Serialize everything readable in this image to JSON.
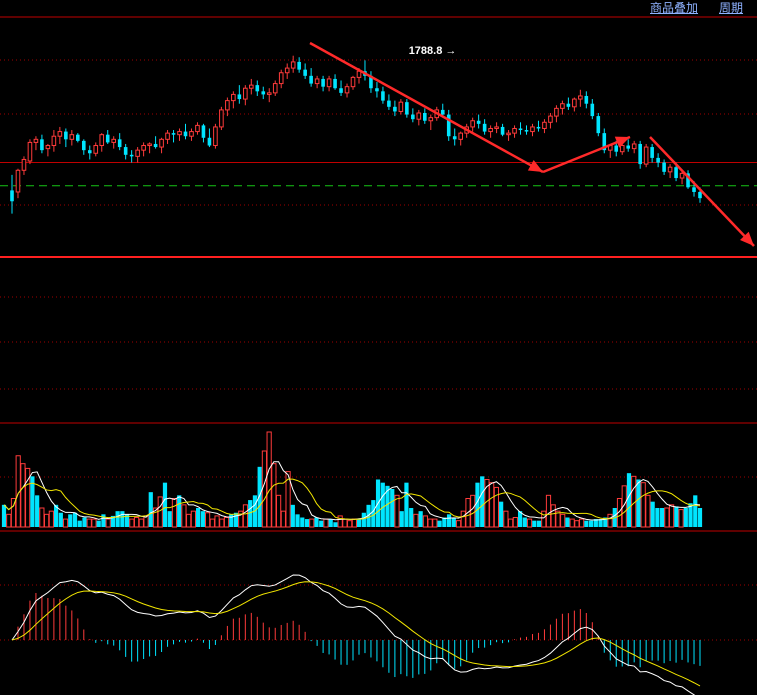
{
  "toolbar": {
    "overlay_label": "商品叠加",
    "period_label": "周期"
  },
  "colors": {
    "background": "#000000",
    "up": "#ff3b3b",
    "down": "#00e5ff",
    "frame": "#c00000",
    "dotted": "#a00000",
    "dashed_support": "#16c616",
    "ma_white": "#ffffff",
    "ma_yellow": "#f2e600",
    "arrow": "#ff2a2a"
  },
  "chart_data": [
    {
      "type": "candlestick",
      "panel": "price",
      "annotations": [
        {
          "text": "1788.8",
          "value": 1788.8,
          "at_index": 75
        }
      ],
      "support_line_value": 1701,
      "resistance_line_value": 1716,
      "floor_line_value": 1661,
      "ylim": [
        1655,
        1810
      ],
      "candles_ohlc": [
        [
          1698,
          1708,
          1683,
          1691
        ],
        [
          1697,
          1712,
          1693,
          1711
        ],
        [
          1711,
          1720,
          1708,
          1718
        ],
        [
          1717,
          1731,
          1715,
          1729
        ],
        [
          1729,
          1733,
          1724,
          1731
        ],
        [
          1731,
          1734,
          1722,
          1724
        ],
        [
          1725,
          1728,
          1720,
          1727
        ],
        [
          1727,
          1737,
          1723,
          1733
        ],
        [
          1733,
          1739,
          1728,
          1736
        ],
        [
          1736,
          1738,
          1726,
          1731
        ],
        [
          1731,
          1737,
          1727,
          1734
        ],
        [
          1734,
          1735,
          1729,
          1730
        ],
        [
          1730,
          1731,
          1721,
          1724
        ],
        [
          1724,
          1727,
          1718,
          1722
        ],
        [
          1722,
          1729,
          1720,
          1727
        ],
        [
          1727,
          1735,
          1723,
          1734
        ],
        [
          1734,
          1737,
          1728,
          1729
        ],
        [
          1729,
          1733,
          1725,
          1731
        ],
        [
          1731,
          1735,
          1724,
          1726
        ],
        [
          1726,
          1728,
          1718,
          1721
        ],
        [
          1721,
          1724,
          1716,
          1720
        ],
        [
          1720,
          1726,
          1716,
          1724
        ],
        [
          1724,
          1729,
          1720,
          1727
        ],
        [
          1727,
          1729,
          1722,
          1728
        ],
        [
          1728,
          1733,
          1725,
          1726
        ],
        [
          1726,
          1732,
          1722,
          1731
        ],
        [
          1731,
          1737,
          1728,
          1735
        ],
        [
          1735,
          1737,
          1729,
          1734
        ],
        [
          1734,
          1738,
          1730,
          1736
        ],
        [
          1736,
          1741,
          1731,
          1733
        ],
        [
          1733,
          1738,
          1730,
          1736
        ],
        [
          1736,
          1742,
          1734,
          1740
        ],
        [
          1740,
          1741,
          1729,
          1732
        ],
        [
          1732,
          1738,
          1726,
          1727
        ],
        [
          1727,
          1741,
          1725,
          1739
        ],
        [
          1739,
          1752,
          1737,
          1750
        ],
        [
          1750,
          1758,
          1746,
          1756
        ],
        [
          1756,
          1762,
          1751,
          1760
        ],
        [
          1760,
          1766,
          1754,
          1757
        ],
        [
          1757,
          1766,
          1753,
          1764
        ],
        [
          1764,
          1770,
          1760,
          1766
        ],
        [
          1766,
          1769,
          1759,
          1762
        ],
        [
          1762,
          1765,
          1757,
          1760
        ],
        [
          1760,
          1764,
          1755,
          1761
        ],
        [
          1761,
          1769,
          1759,
          1767
        ],
        [
          1767,
          1776,
          1764,
          1774
        ],
        [
          1774,
          1780,
          1770,
          1777
        ],
        [
          1777,
          1785,
          1774,
          1781
        ],
        [
          1781,
          1784,
          1774,
          1776
        ],
        [
          1776,
          1780,
          1770,
          1772
        ],
        [
          1772,
          1777,
          1765,
          1767
        ],
        [
          1767,
          1772,
          1764,
          1770
        ],
        [
          1770,
          1772,
          1762,
          1765
        ],
        [
          1765,
          1772,
          1762,
          1770
        ],
        [
          1770,
          1773,
          1763,
          1764
        ],
        [
          1764,
          1769,
          1759,
          1761
        ],
        [
          1761,
          1767,
          1758,
          1765
        ],
        [
          1765,
          1772,
          1763,
          1771
        ],
        [
          1771,
          1777,
          1767,
          1775
        ],
        [
          1775,
          1782,
          1769,
          1772
        ],
        [
          1772,
          1775,
          1761,
          1764
        ],
        [
          1764,
          1768,
          1758,
          1762
        ],
        [
          1762,
          1765,
          1754,
          1756
        ],
        [
          1756,
          1760,
          1750,
          1752
        ],
        [
          1752,
          1756,
          1746,
          1749
        ],
        [
          1749,
          1757,
          1747,
          1755
        ],
        [
          1755,
          1757,
          1745,
          1747
        ],
        [
          1747,
          1751,
          1742,
          1744
        ],
        [
          1744,
          1750,
          1740,
          1748
        ],
        [
          1748,
          1751,
          1741,
          1743
        ],
        [
          1743,
          1747,
          1737,
          1745
        ],
        [
          1745,
          1752,
          1743,
          1750
        ],
        [
          1750,
          1754,
          1745,
          1747
        ],
        [
          1747,
          1750,
          1730,
          1733
        ],
        [
          1733,
          1738,
          1727,
          1731
        ],
        [
          1731,
          1736,
          1727,
          1735
        ],
        [
          1735,
          1741,
          1732,
          1739
        ],
        [
          1739,
          1745,
          1736,
          1743
        ],
        [
          1743,
          1747,
          1738,
          1741
        ],
        [
          1741,
          1744,
          1734,
          1736
        ],
        [
          1736,
          1740,
          1732,
          1738
        ],
        [
          1738,
          1742,
          1735,
          1739
        ],
        [
          1739,
          1741,
          1733,
          1734
        ],
        [
          1734,
          1737,
          1730,
          1735
        ],
        [
          1735,
          1740,
          1732,
          1738
        ],
        [
          1738,
          1742,
          1734,
          1737
        ],
        [
          1737,
          1740,
          1734,
          1736
        ],
        [
          1736,
          1741,
          1733,
          1739
        ],
        [
          1739,
          1743,
          1736,
          1738
        ],
        [
          1738,
          1744,
          1735,
          1742
        ],
        [
          1742,
          1748,
          1738,
          1746
        ],
        [
          1746,
          1753,
          1742,
          1751
        ],
        [
          1751,
          1756,
          1747,
          1754
        ],
        [
          1754,
          1758,
          1750,
          1752
        ],
        [
          1752,
          1758,
          1749,
          1757
        ],
        [
          1757,
          1763,
          1752,
          1759
        ],
        [
          1759,
          1762,
          1751,
          1754
        ],
        [
          1754,
          1757,
          1744,
          1746
        ],
        [
          1746,
          1748,
          1733,
          1735
        ],
        [
          1735,
          1738,
          1722,
          1724
        ],
        [
          1724,
          1728,
          1719,
          1727
        ],
        [
          1727,
          1730,
          1720,
          1723
        ],
        [
          1723,
          1729,
          1721,
          1727
        ],
        [
          1727,
          1731,
          1723,
          1725
        ],
        [
          1725,
          1730,
          1722,
          1728
        ],
        [
          1728,
          1730,
          1712,
          1715
        ],
        [
          1715,
          1728,
          1713,
          1726
        ],
        [
          1726,
          1728,
          1716,
          1719
        ],
        [
          1719,
          1722,
          1713,
          1716
        ],
        [
          1716,
          1718,
          1708,
          1710
        ],
        [
          1710,
          1715,
          1706,
          1713
        ],
        [
          1713,
          1716,
          1704,
          1706
        ],
        [
          1706,
          1711,
          1702,
          1709
        ],
        [
          1709,
          1711,
          1699,
          1700
        ],
        [
          1700,
          1704,
          1694,
          1697
        ],
        [
          1697,
          1700,
          1690,
          1693
        ]
      ]
    },
    {
      "type": "bar",
      "panel": "volume",
      "note": "volume bars with two moving-average lines",
      "values": [
        14,
        8,
        18,
        45,
        40,
        37,
        32,
        20,
        12,
        8,
        10,
        14,
        9,
        5,
        8,
        9,
        4,
        6,
        5,
        5,
        4,
        8,
        5,
        7,
        10,
        10,
        8,
        5,
        6,
        5,
        7,
        22,
        12,
        19,
        28,
        10,
        18,
        20,
        14,
        8,
        10,
        12,
        10,
        9,
        5,
        7,
        5,
        6,
        8,
        9,
        10,
        14,
        17,
        20,
        38,
        48,
        60,
        40,
        20,
        10,
        35,
        14,
        8,
        6,
        5,
        5,
        6,
        4,
        5,
        5,
        3,
        7,
        5,
        4,
        5,
        5,
        9,
        14,
        17,
        30,
        28,
        26,
        24,
        20,
        10,
        28,
        12,
        8,
        10,
        7,
        5,
        5,
        4,
        6,
        8,
        6,
        4,
        10,
        18,
        20,
        28,
        32,
        30,
        28,
        25,
        16,
        10,
        5,
        6,
        10,
        6,
        5,
        4,
        4,
        10,
        20,
        14,
        10,
        8,
        6,
        5,
        4,
        5,
        4,
        4,
        5,
        5,
        6,
        8,
        12,
        18,
        26,
        34,
        32,
        30,
        28,
        20,
        16,
        12,
        12,
        12,
        14,
        13,
        11,
        12,
        15,
        20,
        12
      ],
      "ma_white": [],
      "ma_yellow": []
    },
    {
      "type": "bar",
      "panel": "macd",
      "note": "MACD histogram (positive red, negative cyan) with DIF (white) and DEA (yellow) lines",
      "values": [],
      "dif": [],
      "dea": []
    }
  ]
}
